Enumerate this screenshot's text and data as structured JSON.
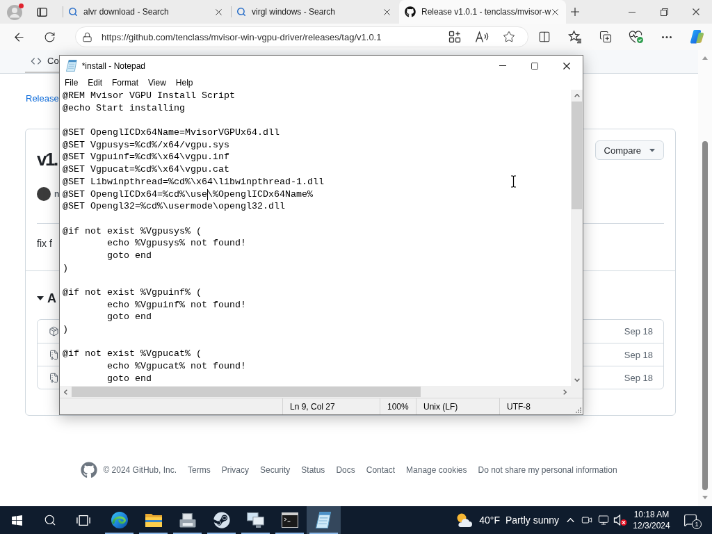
{
  "browser": {
    "tabs": [
      {
        "kind": "search",
        "title": "alvr download - Search",
        "selected": false
      },
      {
        "kind": "search",
        "title": "virgl windows - Search",
        "selected": false
      },
      {
        "kind": "github",
        "title": "Release v1.0.1 - tenclass/mvisor-w",
        "selected": true
      }
    ],
    "address": "https://github.com/tenclass/mvisor-win-vgpu-driver/releases/tag/v1.0.1"
  },
  "page": {
    "repo_tabs": [
      {
        "label": "Co",
        "selected": true
      }
    ],
    "breadcrumb": "Release",
    "release": {
      "title": "v1.",
      "compare_button": "Compare",
      "author": "n",
      "body": "fix f",
      "assets_heading": "A",
      "assets": [
        {
          "kind": "package",
          "date": "Sep 18"
        },
        {
          "kind": "zip",
          "date": "Sep 18"
        },
        {
          "kind": "zip",
          "date": "Sep 18"
        }
      ]
    },
    "footer": {
      "copyright": "© 2024 GitHub, Inc.",
      "links": [
        "Terms",
        "Privacy",
        "Security",
        "Status",
        "Docs",
        "Contact",
        "Manage cookies",
        "Do not share my personal information"
      ]
    }
  },
  "notepad": {
    "title": "*install - Notepad",
    "menu": [
      "File",
      "Edit",
      "Format",
      "View",
      "Help"
    ],
    "blocks": [
      [
        {
          "kind": "text",
          "text": "@REM Mvisor VGPU Install Script"
        },
        {
          "kind": "text",
          "text": "@echo Start installing"
        }
      ],
      [
        {
          "kind": "text",
          "text": "@SET OpenglICDx64Name=MvisorVGPUx64.dll"
        },
        {
          "kind": "text",
          "text": "@SET Vgpusys=%cd%/x64/vgpu.sys"
        },
        {
          "kind": "text",
          "text": "@SET Vgpuinf=%cd%\\x64\\vgpu.inf"
        },
        {
          "kind": "text",
          "text": "@SET Vgpucat=%cd%\\x64\\vgpu.cat"
        },
        {
          "kind": "text",
          "text": "@SET Libwinpthread=%cd%\\x64\\libwinpthread-1.dll"
        },
        {
          "kind": "caret",
          "before_caret": "@SET OpenglICDx64=%cd%\\use",
          "after_caret": "\\%OpenglICDx64Name%"
        },
        {
          "kind": "text",
          "text": "@SET Opengl32=%cd%\\usermode\\opengl32.dll"
        }
      ],
      [
        {
          "kind": "text",
          "text": "@if not exist %Vgpusys% ("
        },
        {
          "kind": "text",
          "text": "\techo %Vgpusys% not found!"
        },
        {
          "kind": "text",
          "text": "\tgoto end"
        },
        {
          "kind": "text",
          "text": ")"
        }
      ],
      [
        {
          "kind": "text",
          "text": "@if not exist %Vgpuinf% ("
        },
        {
          "kind": "text",
          "text": "\techo %Vgpuinf% not found!"
        },
        {
          "kind": "text",
          "text": "\tgoto end"
        },
        {
          "kind": "text",
          "text": ")"
        }
      ],
      [
        {
          "kind": "text",
          "text": "@if not exist %Vgpucat% ("
        },
        {
          "kind": "text",
          "text": "\techo %Vgpucat% not found!"
        },
        {
          "kind": "text",
          "text": "\tgoto end"
        }
      ]
    ],
    "status": {
      "position": "Ln 9, Col 27",
      "zoom": "100%",
      "line_endings": "Unix (LF)",
      "encoding": "UTF-8"
    }
  },
  "taskbar": {
    "apps": [
      {
        "kind": "browser",
        "running": true,
        "selected": false
      },
      {
        "kind": "folder",
        "running": true,
        "selected": false
      },
      {
        "kind": "device",
        "running": true,
        "selected": false
      },
      {
        "kind": "steam",
        "running": true,
        "selected": false
      },
      {
        "kind": "computer",
        "running": true,
        "selected": false
      },
      {
        "kind": "terminal",
        "running": true,
        "selected": false
      },
      {
        "kind": "notepad",
        "running": true,
        "selected": true
      }
    ],
    "weather": {
      "temperature": "40°F",
      "condition": "Partly sunny"
    },
    "volume_muted": true,
    "time": "10:18 AM",
    "date": "12/3/2024",
    "notification_count": "1"
  }
}
